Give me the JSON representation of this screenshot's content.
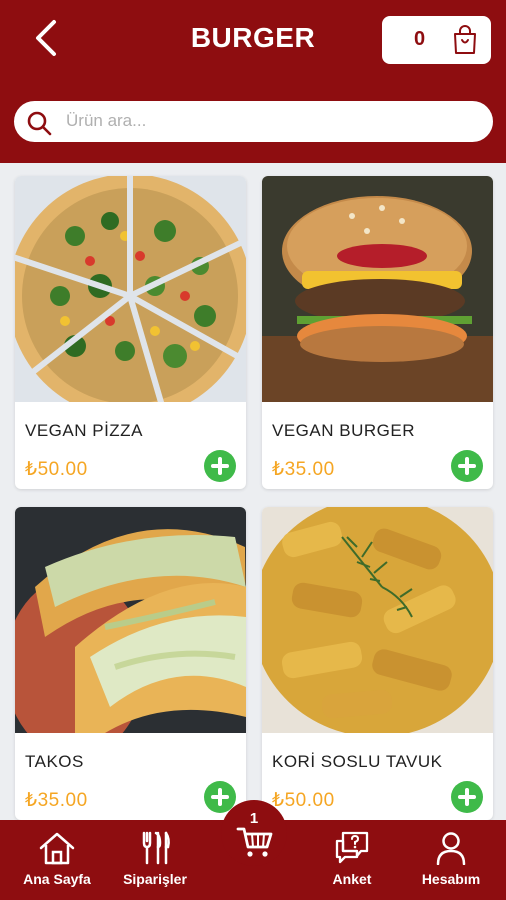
{
  "header": {
    "title": "BURGER",
    "cart_count": "0"
  },
  "search": {
    "placeholder": "Ürün ara..."
  },
  "products": [
    {
      "name": "VEGAN PİZZA",
      "price": "₺50.00"
    },
    {
      "name": "VEGAN BURGER",
      "price": "₺35.00"
    },
    {
      "name": "TAKOS",
      "price": "₺35.00"
    },
    {
      "name": "KORİ SOSLU TAVUK",
      "price": "₺50.00"
    }
  ],
  "bottom_nav": {
    "home": "Ana Sayfa",
    "orders": "Siparişler",
    "cart_badge": "1",
    "survey": "Anket",
    "account": "Hesabım"
  },
  "colors": {
    "brand": "#8e0d10",
    "price": "#f5a623",
    "add": "#3fba49"
  }
}
